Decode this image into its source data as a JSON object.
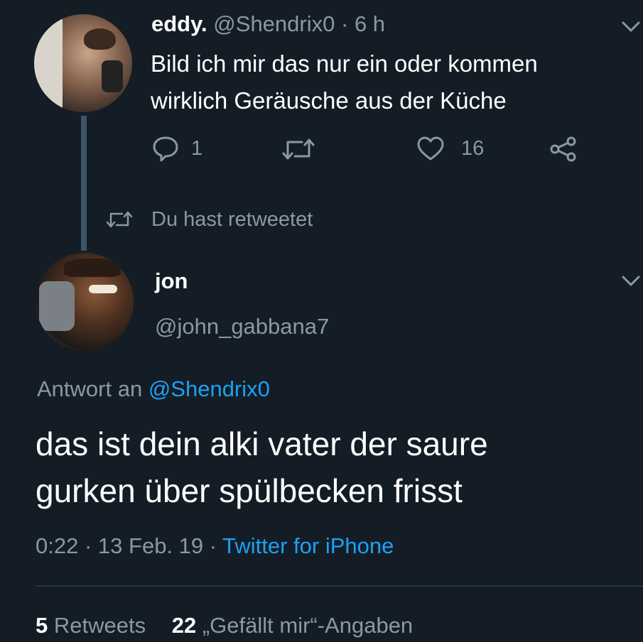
{
  "parent_tweet": {
    "display_name": "eddy.",
    "handle": "@Shendrix0",
    "separator": "·",
    "age": "6 h",
    "text_line1": "Bild ich mir das nur ein oder kommen",
    "text_line2": "wirklich Geräusche aus der Küche",
    "reply_count": "1",
    "like_count": "16"
  },
  "retweet_notice": {
    "label": "Du hast retweetet"
  },
  "main_tweet": {
    "display_name": "jon",
    "handle": "@john_gabbana7",
    "reply_prefix": "Antwort an",
    "reply_to": "@Shendrix0",
    "text_line1": "das ist dein alki vater der saure",
    "text_line2": "gurken über spülbecken frisst",
    "time": "0:22",
    "sep1": "·",
    "date": "13 Feb. 19",
    "sep2": "·",
    "source": "Twitter for iPhone"
  },
  "stats": {
    "retweets_count": "5",
    "retweets_label": "Retweets",
    "likes_count": "22",
    "likes_label": "„Gefällt mir“-Angaben"
  },
  "colors": {
    "background": "#141d26",
    "text": "#ffffff",
    "muted": "#8899a6",
    "accent": "#1da1f2",
    "thread_line": "#3d5466"
  },
  "icons": {
    "reply": "reply-icon",
    "retweet": "retweet-icon",
    "like": "heart-icon",
    "share": "share-icon",
    "more": "chevron-down-icon"
  }
}
